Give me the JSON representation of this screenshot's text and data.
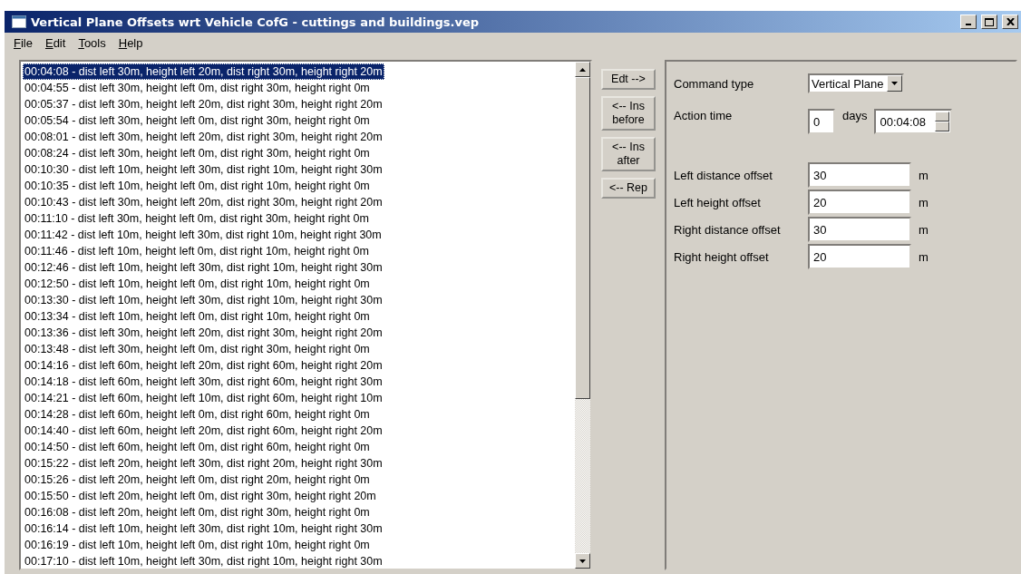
{
  "window": {
    "title": "Vertical Plane Offsets wrt Vehicle CofG  - cuttings and buildings.vep"
  },
  "menu": [
    {
      "label": "File"
    },
    {
      "label": "Edit"
    },
    {
      "label": "Tools"
    },
    {
      "label": "Help"
    }
  ],
  "commands": [
    {
      "text": "00:04:08 - dist left 30m, height left 20m, dist right 30m, height right 20m",
      "selected": true
    },
    {
      "text": "00:04:55 - dist left 30m, height left 0m, dist right 30m, height right 0m",
      "selected": false
    },
    {
      "text": "00:05:37 - dist left 30m, height left 20m, dist right 30m, height right 20m",
      "selected": false
    },
    {
      "text": "00:05:54 - dist left 30m, height left 0m, dist right 30m, height right 0m",
      "selected": false
    },
    {
      "text": "00:08:01 - dist left 30m, height left 20m, dist right 30m, height right 20m",
      "selected": false
    },
    {
      "text": "00:08:24 - dist left 30m, height left 0m, dist right 30m, height right 0m",
      "selected": false
    },
    {
      "text": "00:10:30 - dist left 10m, height left 30m, dist right 10m, height right 30m",
      "selected": false
    },
    {
      "text": "00:10:35 - dist left 10m, height left 0m, dist right 10m, height right 0m",
      "selected": false
    },
    {
      "text": "00:10:43 - dist left 30m, height left 20m, dist right 30m, height right 20m",
      "selected": false
    },
    {
      "text": "00:11:10 - dist left 30m, height left 0m, dist right 30m, height right 0m",
      "selected": false
    },
    {
      "text": "00:11:42 - dist left 10m, height left 30m, dist right 10m, height right 30m",
      "selected": false
    },
    {
      "text": "00:11:46 - dist left 10m, height left 0m, dist right 10m, height right 0m",
      "selected": false
    },
    {
      "text": "00:12:46 - dist left 10m, height left 30m, dist right 10m, height right 30m",
      "selected": false
    },
    {
      "text": "00:12:50 - dist left 10m, height left 0m, dist right 10m, height right 0m",
      "selected": false
    },
    {
      "text": "00:13:30 - dist left 10m, height left 30m, dist right 10m, height right 30m",
      "selected": false
    },
    {
      "text": "00:13:34 - dist left 10m, height left 0m, dist right 10m, height right 0m",
      "selected": false
    },
    {
      "text": "00:13:36 - dist left 30m, height left 20m, dist right 30m, height right 20m",
      "selected": false
    },
    {
      "text": "00:13:48 - dist left 30m, height left 0m, dist right 30m, height right 0m",
      "selected": false
    },
    {
      "text": "00:14:16 - dist left 60m, height left 20m, dist right 60m, height right 20m",
      "selected": false
    },
    {
      "text": "00:14:18 - dist left 60m, height left 30m, dist right 60m, height right 30m",
      "selected": false
    },
    {
      "text": "00:14:21 - dist left 60m, height left 10m, dist right 60m, height right 10m",
      "selected": false
    },
    {
      "text": "00:14:28 - dist left 60m, height left 0m, dist right 60m, height right 0m",
      "selected": false
    },
    {
      "text": "00:14:40 - dist left 60m, height left 20m, dist right 60m, height right 20m",
      "selected": false
    },
    {
      "text": "00:14:50 - dist left 60m, height left 0m, dist right 60m, height right 0m",
      "selected": false
    },
    {
      "text": "00:15:22 - dist left 20m, height left 30m, dist right 20m, height right 30m",
      "selected": false
    },
    {
      "text": "00:15:26 - dist left 20m, height left 0m, dist right 20m, height right 0m",
      "selected": false
    },
    {
      "text": "00:15:50 - dist left 20m, height left 0m, dist right 30m, height right 20m",
      "selected": false
    },
    {
      "text": "00:16:08 - dist left 20m, height left 0m, dist right 30m, height right 0m",
      "selected": false
    },
    {
      "text": "00:16:14 - dist left 10m, height left 30m, dist right 10m, height right 30m",
      "selected": false
    },
    {
      "text": "00:16:19 - dist left 10m, height left 0m, dist right 10m, height right 0m",
      "selected": false
    },
    {
      "text": "00:17:10 - dist left 10m, height left 30m, dist right 10m, height right 30m",
      "selected": false
    }
  ],
  "action_buttons": [
    "Edt -->",
    "<-- Ins before",
    "<-- Ins after",
    "<-- Rep"
  ],
  "editor": {
    "command_type": {
      "label": "Command type",
      "value": "Vertical Plane"
    },
    "action_time": {
      "label": "Action time",
      "days": "0",
      "days_unit": "days",
      "time": "00:04:08"
    },
    "offsets": [
      {
        "label": "Left distance offset",
        "value": "30",
        "unit": "m"
      },
      {
        "label": "Left height offset",
        "value": "20",
        "unit": "m"
      },
      {
        "label": "Right distance offset",
        "value": "30",
        "unit": "m"
      },
      {
        "label": "Right height offset",
        "value": "20",
        "unit": "m"
      }
    ]
  }
}
